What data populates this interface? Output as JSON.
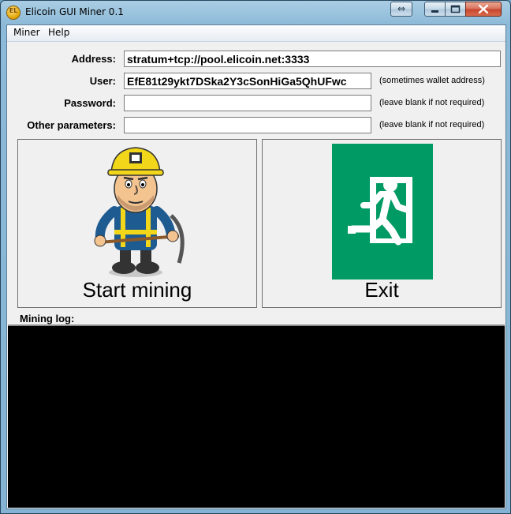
{
  "window": {
    "title": "Elicoin GUI Miner 0.1",
    "icon_text": "EL"
  },
  "titlebar_buttons": {
    "resize": "⇔",
    "minimize": "▭",
    "maximize": "☐",
    "close": "✕"
  },
  "menu": [
    {
      "label": "Miner"
    },
    {
      "label": "Help"
    }
  ],
  "form": {
    "address": {
      "label": "Address:",
      "value": "stratum+tcp://pool.elicoin.net:3333"
    },
    "user": {
      "label": "User:",
      "value": "EfE81t29ykt7DSka2Y3cSonHiGa5QhUFwc",
      "hint": "(sometimes wallet address)"
    },
    "password": {
      "label": "Password:",
      "value": "",
      "hint": "(leave blank if not required)"
    },
    "other": {
      "label": "Other parameters:",
      "value": "",
      "hint": "(leave blank if not required)"
    }
  },
  "buttons": {
    "start": "Start mining",
    "exit": "Exit"
  },
  "log": {
    "label": "Mining log:",
    "content": ""
  },
  "colors": {
    "exit_sign": "#009a64",
    "log_bg": "#000000",
    "helmet": "#f2d619"
  }
}
